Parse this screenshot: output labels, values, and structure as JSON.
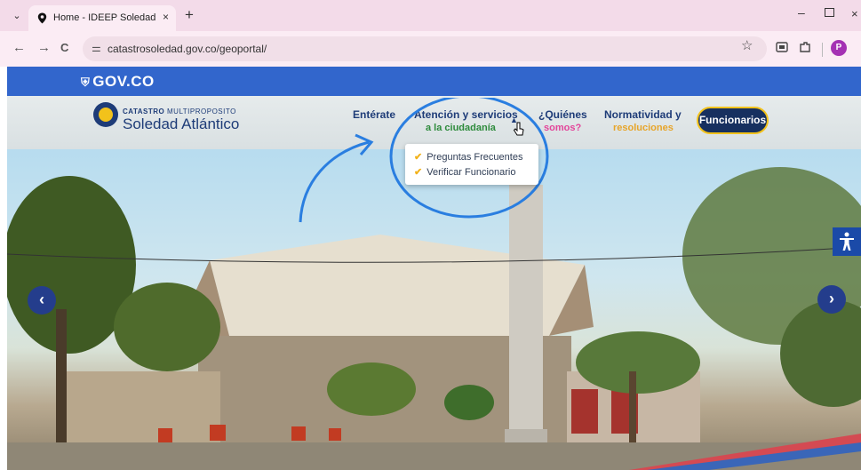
{
  "browser": {
    "tab_title": "Home - IDEEP Soledad",
    "tab_close": "×",
    "new_tab": "+",
    "url": "catastrosoledad.gov.co/geoportal/",
    "profile_initial": "P",
    "back": "←",
    "forward": "→",
    "reload": "C",
    "menu": "⌄",
    "minimize": "–",
    "close": "×",
    "star": "☆",
    "site_info": "⚌"
  },
  "gov": {
    "logo": "GOV.CO",
    "shield": "⛨"
  },
  "brand": {
    "top_bold": "CATASTRO",
    "top_light": "MULTIPROPOSITO",
    "name": "Soledad Atlántico"
  },
  "nav": {
    "enterate": "Entérate",
    "atencion": "Atención y servicios",
    "atencion_sub": "a la ciudadanía",
    "quienes": "¿Quiénes",
    "quienes_sub": "somos?",
    "normatividad": "Normatividad y",
    "normatividad_sub": "resoluciones",
    "funcionarios": "Funcionarios",
    "caret": "▲"
  },
  "dropdown": {
    "check": "✔",
    "items": [
      "Preguntas Frecuentes",
      "Verificar Funcionario"
    ]
  },
  "hero": {
    "prev": "‹",
    "next": "›",
    "a11y_icon": "accessibility-icon"
  },
  "colors": {
    "gov_blue": "#3266cc",
    "brand_navy": "#1e3c78",
    "brand_yellow": "#f2c21b",
    "sub_green": "#2e8b3c",
    "sub_pink": "#e3459a",
    "sub_orange": "#e7a52a"
  }
}
